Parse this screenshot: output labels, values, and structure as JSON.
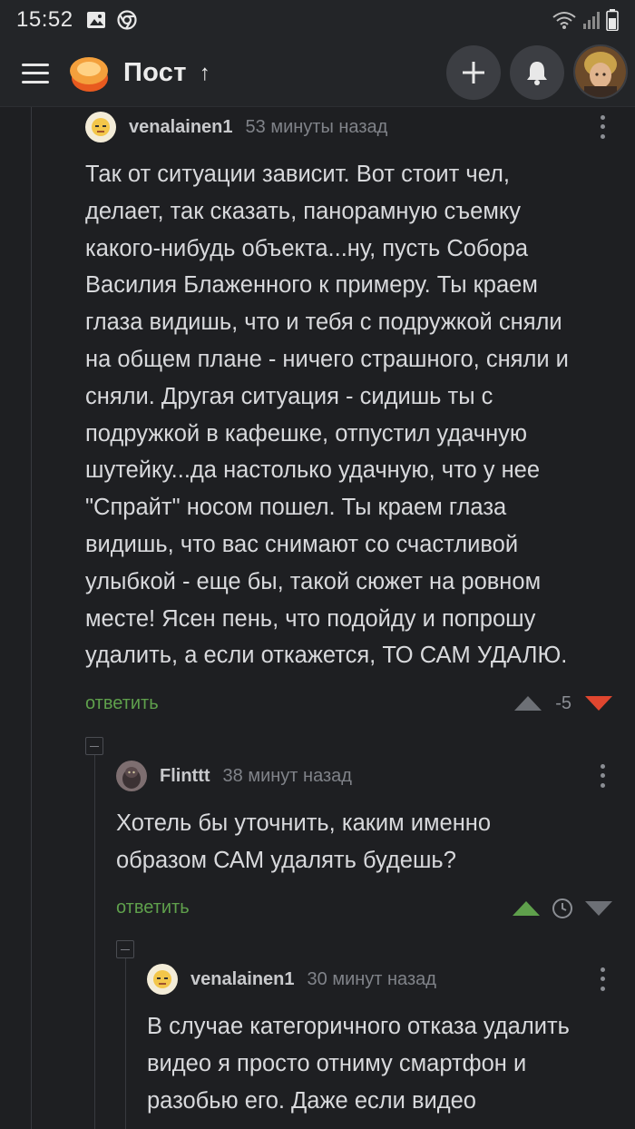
{
  "status_bar": {
    "time": "15:52",
    "icons": [
      "image-icon",
      "chrome-icon",
      "wifi-icon",
      "signal-icon",
      "battery-icon"
    ]
  },
  "app_bar": {
    "title": "Пост",
    "up_arrow": "↑",
    "actions": [
      "add-button",
      "notifications-button",
      "profile-avatar"
    ],
    "accent": "#f4a03c"
  },
  "comments": [
    {
      "user": "venalainen1",
      "time": "53 минуты назад",
      "lines": [
        "Так от ситуации зависит. Вот стоит чел,",
        "делает, так сказать, панорамную съемку",
        "какого-нибудь объекта...ну, пусть Собора",
        "Василия Блаженного к примеру. Ты краем",
        "глаза видишь, что и тебя с подружкой сняли",
        "на общем плане - ничего страшного, сняли и",
        "сняли. Другая ситуация - сидишь ты с",
        "подружкой в кафешке, отпустил удачную",
        "шутейку...да настолько удачную, что у нее",
        "\"Спрайт\" носом пошел. Ты краем глаза",
        "видишь, что вас снимают со счастливой",
        "улыбкой - еще бы, такой сюжет на ровном",
        "месте! Ясен пень, что подойду и попрошу",
        "удалить, а если откажется, ТО САМ УДАЛЮ."
      ],
      "reply_label": "ответить",
      "score": "-5",
      "vote_state": "down",
      "colors": {
        "down": "#e0462f",
        "neutral": "#6d7076"
      }
    },
    {
      "user": "Flinttt",
      "time": "38 минут назад",
      "lines": [
        "Хотель бы уточнить, каким именно",
        "образом САМ удалять будешь?"
      ],
      "reply_label": "ответить",
      "score": "",
      "vote_state": "up",
      "colors": {
        "up": "#5fa04c",
        "neutral": "#6d7076"
      }
    },
    {
      "user": "venalainen1",
      "time": "30 минут назад",
      "lines": [
        "В случае категоричного отказа удалить",
        "видео я просто отниму смартфон и",
        "разобью его. Даже если видео"
      ]
    }
  ]
}
